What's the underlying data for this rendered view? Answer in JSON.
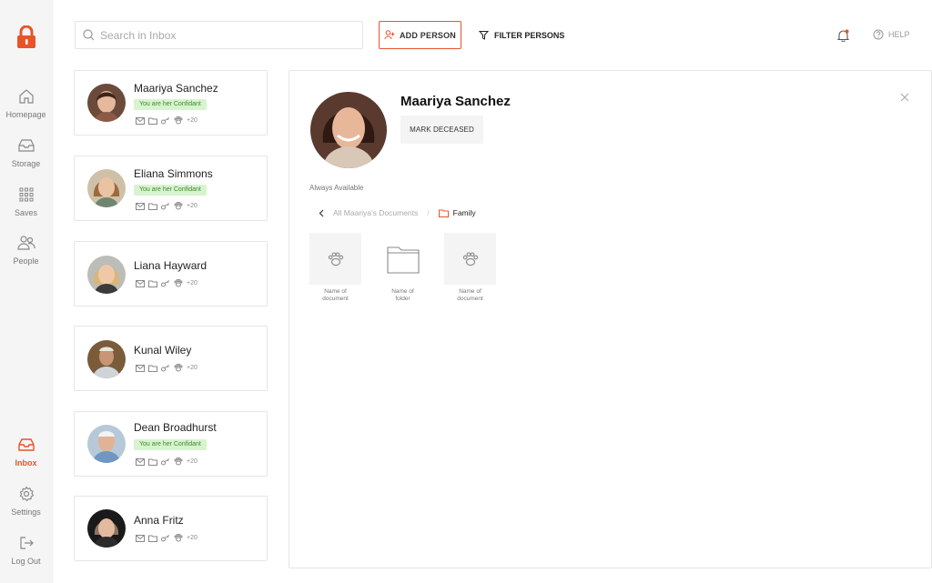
{
  "sidebar": {
    "items": [
      {
        "label": "Homepage"
      },
      {
        "label": "Storage"
      },
      {
        "label": "Saves"
      },
      {
        "label": "People"
      },
      {
        "label": "Inbox"
      },
      {
        "label": "Settings"
      },
      {
        "label": "Log Out"
      }
    ]
  },
  "colors": {
    "accent": "#e8542a",
    "badge_bg": "#d8f3cf",
    "badge_text": "#3f8a2f"
  },
  "search": {
    "placeholder": "Search in Inbox"
  },
  "toolbar": {
    "add_person": "ADD PERSON",
    "filter_persons": "FILTER PERSONS",
    "help": "HELP"
  },
  "people": [
    {
      "name": "Maariya Sanchez",
      "badge": "You are her Confidant",
      "count": "+20"
    },
    {
      "name": "Eliana Simmons",
      "badge": "You are her Confidant",
      "count": "+20"
    },
    {
      "name": "Liana Hayward",
      "badge": "",
      "count": "+20"
    },
    {
      "name": "Kunal Wiley",
      "badge": "",
      "count": "+20"
    },
    {
      "name": "Dean Broadhurst",
      "badge": "You are her Confidant",
      "count": "+20"
    },
    {
      "name": "Anna Fritz",
      "badge": "",
      "count": "+20"
    }
  ],
  "detail": {
    "name": "Maariya Sanchez",
    "mark_deceased": "MARK DECEASED",
    "availability": "Always Available",
    "breadcrumb": {
      "all": "All Maariya's Documents",
      "separator": "/",
      "current": "Family"
    },
    "items": [
      {
        "label": "Name of document",
        "kind": "paw-icon"
      },
      {
        "label": "Name of folder",
        "kind": "folder-icon"
      },
      {
        "label": "Name of document",
        "kind": "paw-icon"
      }
    ]
  }
}
